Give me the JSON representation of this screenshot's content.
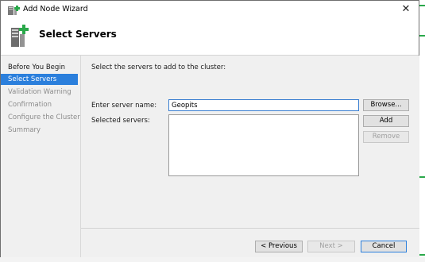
{
  "window": {
    "title": "Add Node Wizard",
    "close_symbol": "✕"
  },
  "header": {
    "title": "Select Servers",
    "icon": "server-cluster-add-icon"
  },
  "nav": {
    "items": [
      {
        "label": "Before You Begin",
        "state": "normal"
      },
      {
        "label": "Select Servers",
        "state": "active"
      },
      {
        "label": "Validation Warning",
        "state": "disabled"
      },
      {
        "label": "Confirmation",
        "state": "disabled"
      },
      {
        "label": "Configure the Cluster",
        "state": "disabled"
      },
      {
        "label": "Summary",
        "state": "disabled"
      }
    ]
  },
  "main": {
    "instruction": "Select the servers to add to the cluster:",
    "server_name_label": "Enter server name:",
    "server_name_value": "Geopits",
    "selected_servers_label": "Selected servers:",
    "browse_label": "Browse...",
    "add_label": "Add",
    "remove_label": "Remove"
  },
  "footer": {
    "previous_label": "< Previous",
    "next_label": "Next >",
    "cancel_label": "Cancel"
  },
  "colors": {
    "accent": "#2b7fdc",
    "panel_bg": "#f0f0f0"
  }
}
